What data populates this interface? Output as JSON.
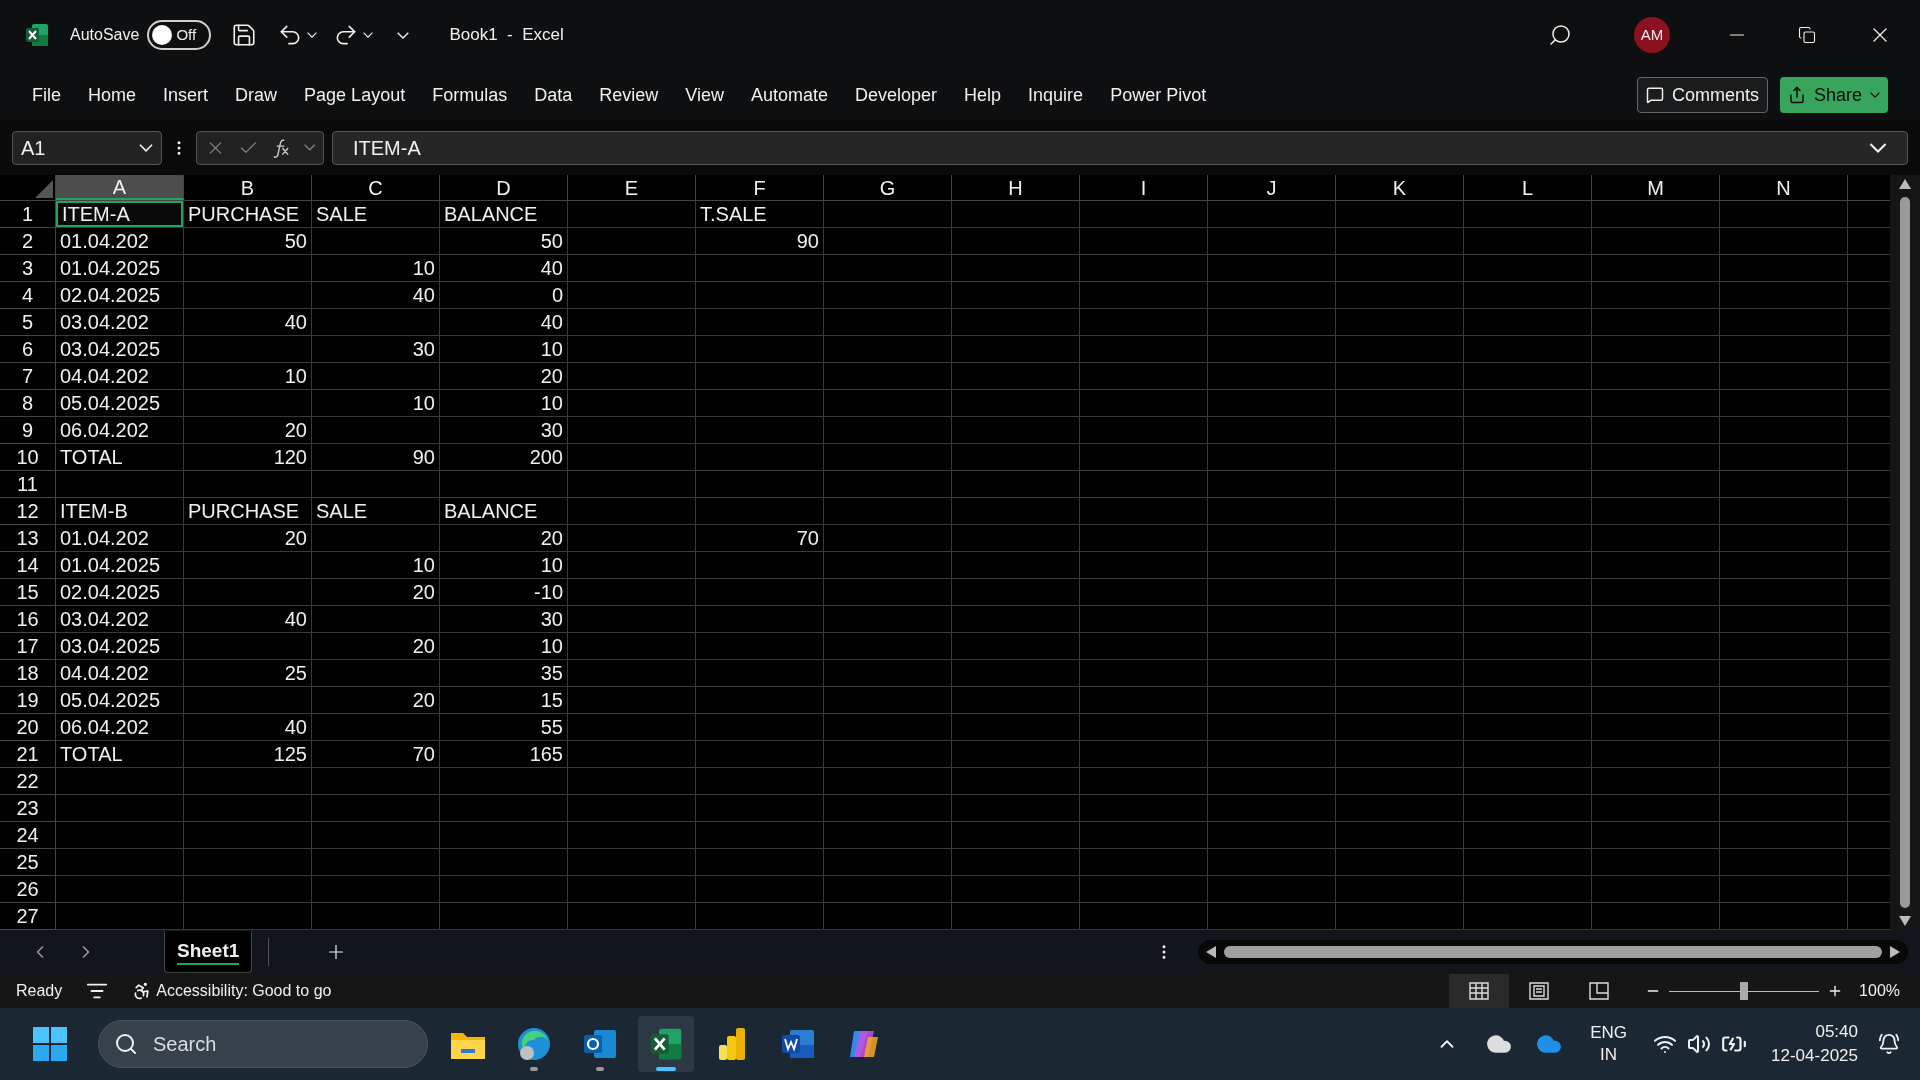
{
  "title_bar": {
    "autosave_label": "AutoSave",
    "autosave_on": false,
    "autosave_state": "Off",
    "document_title": "Book1  -  Excel",
    "avatar": "AM"
  },
  "ribbon_tabs": [
    {
      "label": "File"
    },
    {
      "label": "Home"
    },
    {
      "label": "Insert"
    },
    {
      "label": "Draw"
    },
    {
      "label": "Page Layout"
    },
    {
      "label": "Formulas"
    },
    {
      "label": "Data"
    },
    {
      "label": "Review"
    },
    {
      "label": "View"
    },
    {
      "label": "Automate"
    },
    {
      "label": "Developer"
    },
    {
      "label": "Help"
    },
    {
      "label": "Inquire"
    },
    {
      "label": "Power Pivot"
    }
  ],
  "ribbon_buttons": {
    "comments": "Comments",
    "share": "Share"
  },
  "formula_bar": {
    "name_box": "A1",
    "formula": "ITEM-A"
  },
  "sheet": {
    "columns": [
      {
        "label": "A",
        "selected": true
      },
      {
        "label": "B",
        "selected": false
      },
      {
        "label": "C",
        "selected": false
      },
      {
        "label": "D",
        "selected": false
      },
      {
        "label": "E",
        "selected": false
      },
      {
        "label": "F",
        "selected": false
      },
      {
        "label": "G",
        "selected": false
      },
      {
        "label": "H",
        "selected": false
      },
      {
        "label": "I",
        "selected": false
      },
      {
        "label": "J",
        "selected": false
      },
      {
        "label": "K",
        "selected": false
      },
      {
        "label": "L",
        "selected": false
      },
      {
        "label": "M",
        "selected": false
      },
      {
        "label": "N",
        "selected": false
      }
    ],
    "rows": [
      {
        "number": "1",
        "A": {
          "text": "ITEM-A",
          "kind": "text",
          "selected": true
        },
        "B": {
          "text": "PURCHASE",
          "kind": "text",
          "selected": false
        },
        "C": {
          "text": "SALE",
          "kind": "text",
          "selected": false
        },
        "D": {
          "text": "BALANCE",
          "kind": "text",
          "selected": false
        },
        "F": {
          "text": "T.SALE",
          "kind": "text",
          "selected": false
        }
      },
      {
        "number": "2",
        "A": {
          "text": "01.04.202",
          "kind": "text",
          "selected": false
        },
        "B": {
          "text": "50",
          "kind": "number",
          "selected": false
        },
        "D": {
          "text": "50",
          "kind": "number",
          "selected": false
        },
        "F": {
          "text": "90",
          "kind": "number",
          "selected": false
        }
      },
      {
        "number": "3",
        "A": {
          "text": "01.04.2025",
          "kind": "text",
          "selected": false
        },
        "C": {
          "text": "10",
          "kind": "number",
          "selected": false
        },
        "D": {
          "text": "40",
          "kind": "number",
          "selected": false
        }
      },
      {
        "number": "4",
        "A": {
          "text": "02.04.2025",
          "kind": "text",
          "selected": false
        },
        "C": {
          "text": "40",
          "kind": "number",
          "selected": false
        },
        "D": {
          "text": "0",
          "kind": "number",
          "selected": false
        }
      },
      {
        "number": "5",
        "A": {
          "text": "03.04.202",
          "kind": "text",
          "selected": false
        },
        "B": {
          "text": "40",
          "kind": "number",
          "selected": false
        },
        "D": {
          "text": "40",
          "kind": "number",
          "selected": false
        }
      },
      {
        "number": "6",
        "A": {
          "text": "03.04.2025",
          "kind": "text",
          "selected": false
        },
        "C": {
          "text": "30",
          "kind": "number",
          "selected": false
        },
        "D": {
          "text": "10",
          "kind": "number",
          "selected": false
        }
      },
      {
        "number": "7",
        "A": {
          "text": "04.04.202",
          "kind": "text",
          "selected": false
        },
        "B": {
          "text": "10",
          "kind": "number",
          "selected": false
        },
        "D": {
          "text": "20",
          "kind": "number",
          "selected": false
        }
      },
      {
        "number": "8",
        "A": {
          "text": "05.04.2025",
          "kind": "text",
          "selected": false
        },
        "C": {
          "text": "10",
          "kind": "number",
          "selected": false
        },
        "D": {
          "text": "10",
          "kind": "number",
          "selected": false
        }
      },
      {
        "number": "9",
        "A": {
          "text": "06.04.202",
          "kind": "text",
          "selected": false
        },
        "B": {
          "text": "20",
          "kind": "number",
          "selected": false
        },
        "D": {
          "text": "30",
          "kind": "number",
          "selected": false
        }
      },
      {
        "number": "10",
        "A": {
          "text": "TOTAL",
          "kind": "text",
          "selected": false
        },
        "B": {
          "text": "120",
          "kind": "number",
          "selected": false
        },
        "C": {
          "text": "90",
          "kind": "number",
          "selected": false
        },
        "D": {
          "text": "200",
          "kind": "number",
          "selected": false
        }
      },
      {
        "number": "11"
      },
      {
        "number": "12",
        "A": {
          "text": "ITEM-B",
          "kind": "text",
          "selected": false
        },
        "B": {
          "text": "PURCHASE",
          "kind": "text",
          "selected": false
        },
        "C": {
          "text": "SALE",
          "kind": "text",
          "selected": false
        },
        "D": {
          "text": "BALANCE",
          "kind": "text",
          "selected": false
        }
      },
      {
        "number": "13",
        "A": {
          "text": "01.04.202",
          "kind": "text",
          "selected": false
        },
        "B": {
          "text": "20",
          "kind": "number",
          "selected": false
        },
        "D": {
          "text": "20",
          "kind": "number",
          "selected": false
        },
        "F": {
          "text": "70",
          "kind": "number",
          "selected": false
        }
      },
      {
        "number": "14",
        "A": {
          "text": "01.04.2025",
          "kind": "text",
          "selected": false
        },
        "C": {
          "text": "10",
          "kind": "number",
          "selected": false
        },
        "D": {
          "text": "10",
          "kind": "number",
          "selected": false
        }
      },
      {
        "number": "15",
        "A": {
          "text": "02.04.2025",
          "kind": "text",
          "selected": false
        },
        "C": {
          "text": "20",
          "kind": "number",
          "selected": false
        },
        "D": {
          "text": "-10",
          "kind": "number",
          "selected": false
        }
      },
      {
        "number": "16",
        "A": {
          "text": "03.04.202",
          "kind": "text",
          "selected": false
        },
        "B": {
          "text": "40",
          "kind": "number",
          "selected": false
        },
        "D": {
          "text": "30",
          "kind": "number",
          "selected": false
        }
      },
      {
        "number": "17",
        "A": {
          "text": "03.04.2025",
          "kind": "text",
          "selected": false
        },
        "C": {
          "text": "20",
          "kind": "number",
          "selected": false
        },
        "D": {
          "text": "10",
          "kind": "number",
          "selected": false
        }
      },
      {
        "number": "18",
        "A": {
          "text": "04.04.202",
          "kind": "text",
          "selected": false
        },
        "B": {
          "text": "25",
          "kind": "number",
          "selected": false
        },
        "D": {
          "text": "35",
          "kind": "number",
          "selected": false
        }
      },
      {
        "number": "19",
        "A": {
          "text": "05.04.2025",
          "kind": "text",
          "selected": false
        },
        "C": {
          "text": "20",
          "kind": "number",
          "selected": false
        },
        "D": {
          "text": "15",
          "kind": "number",
          "selected": false
        }
      },
      {
        "number": "20",
        "A": {
          "text": "06.04.202",
          "kind": "text",
          "selected": false
        },
        "B": {
          "text": "40",
          "kind": "number",
          "selected": false
        },
        "D": {
          "text": "55",
          "kind": "number",
          "selected": false
        }
      },
      {
        "number": "21",
        "A": {
          "text": "TOTAL",
          "kind": "text",
          "selected": false
        },
        "B": {
          "text": "125",
          "kind": "number",
          "selected": false
        },
        "C": {
          "text": "70",
          "kind": "number",
          "selected": false
        },
        "D": {
          "text": "165",
          "kind": "number",
          "selected": false
        }
      },
      {
        "number": "22"
      },
      {
        "number": "23"
      },
      {
        "number": "24"
      },
      {
        "number": "25"
      },
      {
        "number": "26"
      },
      {
        "number": "27"
      }
    ]
  },
  "sheet_tabs": [
    {
      "label": "Sheet1",
      "selected": true
    }
  ],
  "status_bar": {
    "status": "Ready",
    "accessibility": "Accessibility: Good to go",
    "views": [
      {
        "kind": "normal",
        "selected": true
      },
      {
        "kind": "page_layout",
        "selected": false
      },
      {
        "kind": "page_break",
        "selected": false
      }
    ],
    "zoom_slider": {
      "level": 0.5
    },
    "zoom": "100%"
  },
  "taskbar": {
    "search_placeholder": "Search",
    "apps": [
      {
        "kind": "explorer",
        "running": false,
        "active": false
      },
      {
        "kind": "edge",
        "running": true,
        "active": false
      },
      {
        "kind": "outlook",
        "running": true,
        "active": false
      },
      {
        "kind": "excel",
        "running": true,
        "active": true
      },
      {
        "kind": "powerbi",
        "running": false,
        "active": false
      },
      {
        "kind": "word",
        "running": false,
        "active": false
      },
      {
        "kind": "copilot",
        "running": false,
        "active": false
      }
    ],
    "language": "ENG",
    "region": "IN",
    "time": "05:40",
    "date": "12-04-2025"
  }
}
